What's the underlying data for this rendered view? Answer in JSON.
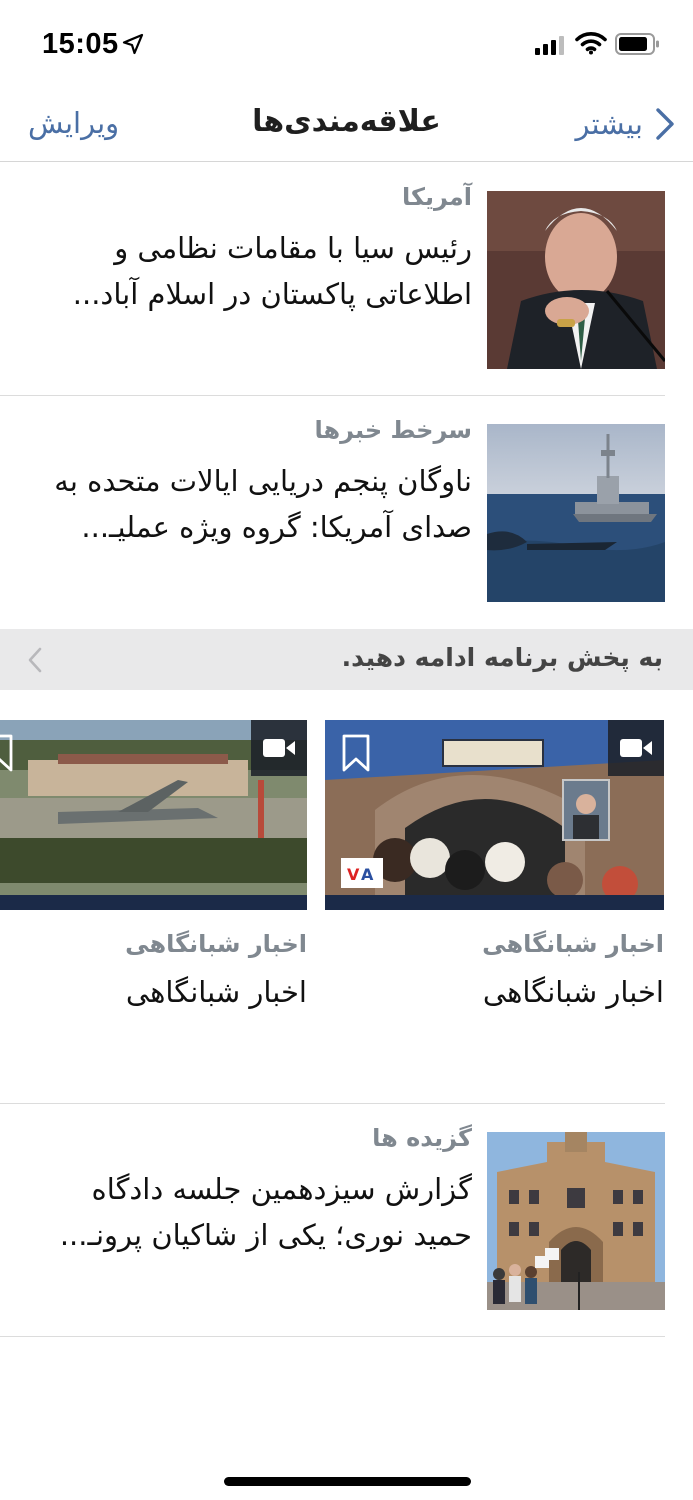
{
  "status_bar": {
    "time": "15:05"
  },
  "nav": {
    "edit_label": "ویرایش",
    "title": "علاقه‌مندی‌ها",
    "more_label": "بیشتر"
  },
  "articles": [
    {
      "category": "آمریکا",
      "title": "رئیس سیا با مقامات نظامی و اطلاعاتی پاکستان در اسلام آباد..."
    },
    {
      "category": "سرخط خبرها",
      "title": "ناوگان پنجم دریایی ایالات متحده به صدای آمریکا: گروه ویژه عملیـ..."
    }
  ],
  "continue_watching": {
    "label": "به پخش برنامه ادامه دهید."
  },
  "videos": [
    {
      "category": "اخبار شبانگاهی",
      "title": "اخبار شبانگاهی"
    },
    {
      "category": "اخبار شبانگاهی",
      "title": "اخبار شبانگاهی"
    }
  ],
  "highlights": {
    "category": "گزیده ها",
    "title": "گزارش سیزدهمین جلسه دادگاه حمید نوری؛ یکی از شاکیان پرونـ..."
  }
}
